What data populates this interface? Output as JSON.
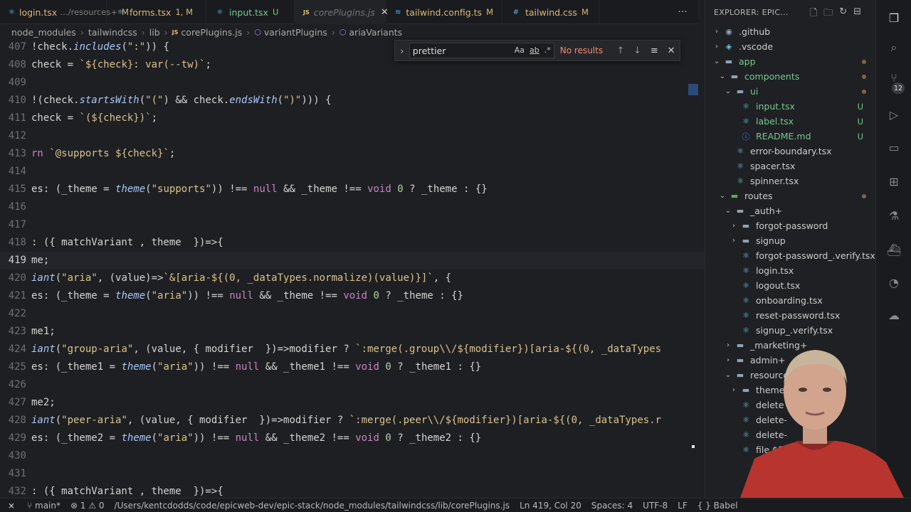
{
  "tabs": [
    {
      "label": "login.tsx",
      "path": "…/resources+",
      "badge": "M",
      "icon": "react-icon"
    },
    {
      "label": "forms.tsx",
      "path": "",
      "badge": "1, M",
      "icon": "react-icon"
    },
    {
      "label": "input.tsx",
      "path": "",
      "badge": "U",
      "icon": "react-icon"
    },
    {
      "label": "corePlugins.js",
      "path": "",
      "badge": "",
      "icon": "js-icon",
      "active": true
    },
    {
      "label": "tailwind.config.ts",
      "path": "",
      "badge": "M",
      "icon": "tailwind-icon"
    },
    {
      "label": "tailwind.css",
      "path": "",
      "badge": "M",
      "icon": "css-icon"
    }
  ],
  "breadcrumb": [
    "node_modules",
    "tailwindcss",
    "lib",
    "corePlugins.js",
    "variantPlugins",
    "ariaVariants"
  ],
  "find": {
    "query": "prettier",
    "opt_case": "Aa",
    "opt_word": "ab",
    "opt_regex": ".*",
    "result": "No results"
  },
  "editor": {
    "lines": [
      {
        "n": "407",
        "t": "!check.includes(\":\")) {"
      },
      {
        "n": "408",
        "t": "check = `${check}: var(--tw)`;"
      },
      {
        "n": "409",
        "t": ""
      },
      {
        "n": "410",
        "t": "!(check.startsWith(\"(\") && check.endsWith(\")\"))) {"
      },
      {
        "n": "411",
        "t": "check = `(${check})`;"
      },
      {
        "n": "412",
        "t": ""
      },
      {
        "n": "413",
        "t": "rn `@supports ${check}`;"
      },
      {
        "n": "414",
        "t": ""
      },
      {
        "n": "415",
        "t": "es: (_theme = theme(\"supports\")) !== null && _theme !== void 0 ? _theme : {}"
      },
      {
        "n": "416",
        "t": ""
      },
      {
        "n": "417",
        "t": ""
      },
      {
        "n": "418",
        "t": ": ({ matchVariant , theme  })=>{"
      },
      {
        "n": "419",
        "t": "me;"
      },
      {
        "n": "420",
        "t": "iant(\"aria\", (value)=>`&[aria-${(0, _dataTypes.normalize)(value)}]`, {"
      },
      {
        "n": "421",
        "t": "es: (_theme = theme(\"aria\")) !== null && _theme !== void 0 ? _theme : {}"
      },
      {
        "n": "422",
        "t": ""
      },
      {
        "n": "423",
        "t": "me1;"
      },
      {
        "n": "424",
        "t": "iant(\"group-aria\", (value, { modifier  })=>modifier ? `:merge(.group\\\\/${modifier})[aria-${(0, _dataTypes"
      },
      {
        "n": "425",
        "t": "es: (_theme1 = theme(\"aria\")) !== null && _theme1 !== void 0 ? _theme1 : {}"
      },
      {
        "n": "426",
        "t": ""
      },
      {
        "n": "427",
        "t": "me2;"
      },
      {
        "n": "428",
        "t": "iant(\"peer-aria\", (value, { modifier  })=>modifier ? `:merge(.peer\\\\/${modifier})[aria-${(0, _dataTypes.r"
      },
      {
        "n": "429",
        "t": "es: (_theme2 = theme(\"aria\")) !== null && _theme2 !== void 0 ? _theme2 : {}"
      },
      {
        "n": "430",
        "t": ""
      },
      {
        "n": "431",
        "t": ""
      },
      {
        "n": "432",
        "t": ": ({ matchVariant , theme  })=>{"
      }
    ],
    "current_line": "419"
  },
  "explorer": {
    "title": "EXPLORER: EPIC...",
    "tree": [
      {
        "label": ".github",
        "depth": 0,
        "kind": "folder",
        "chev": "right",
        "icon": "github-folder-icon"
      },
      {
        "label": ".vscode",
        "depth": 0,
        "kind": "folder",
        "chev": "right",
        "icon": "vscode-folder-icon"
      },
      {
        "label": "app",
        "depth": 0,
        "kind": "folder",
        "chev": "down",
        "icon": "folder-icon",
        "status": "dot",
        "color": "green"
      },
      {
        "label": "components",
        "depth": 1,
        "kind": "folder",
        "chev": "down",
        "icon": "folder-icon",
        "status": "dot",
        "color": "green"
      },
      {
        "label": "ui",
        "depth": 2,
        "kind": "folder",
        "chev": "down",
        "icon": "folder-icon",
        "status": "dot",
        "color": "green"
      },
      {
        "label": "input.tsx",
        "depth": 3,
        "kind": "file",
        "icon": "react-icon",
        "badge": "U",
        "color": "green"
      },
      {
        "label": "label.tsx",
        "depth": 3,
        "kind": "file",
        "icon": "react-icon",
        "badge": "U",
        "color": "green"
      },
      {
        "label": "README.md",
        "depth": 3,
        "kind": "file",
        "icon": "info-icon",
        "badge": "U",
        "color": "green"
      },
      {
        "label": "error-boundary.tsx",
        "depth": 2,
        "kind": "file",
        "icon": "react-icon"
      },
      {
        "label": "spacer.tsx",
        "depth": 2,
        "kind": "file",
        "icon": "react-icon"
      },
      {
        "label": "spinner.tsx",
        "depth": 2,
        "kind": "file",
        "icon": "react-icon"
      },
      {
        "label": "routes",
        "depth": 1,
        "kind": "folder",
        "chev": "down",
        "icon": "folder-green-icon",
        "status": "dot"
      },
      {
        "label": "_auth+",
        "depth": 2,
        "kind": "folder",
        "chev": "down",
        "icon": "folder-icon"
      },
      {
        "label": "forgot-password",
        "depth": 3,
        "kind": "folder",
        "chev": "right",
        "icon": "folder-icon"
      },
      {
        "label": "signup",
        "depth": 3,
        "kind": "folder",
        "chev": "right",
        "icon": "folder-icon"
      },
      {
        "label": "forgot-password_.verify.tsx",
        "depth": 3,
        "kind": "file",
        "icon": "react-icon"
      },
      {
        "label": "login.tsx",
        "depth": 3,
        "kind": "file",
        "icon": "react-icon"
      },
      {
        "label": "logout.tsx",
        "depth": 3,
        "kind": "file",
        "icon": "react-icon"
      },
      {
        "label": "onboarding.tsx",
        "depth": 3,
        "kind": "file",
        "icon": "react-icon"
      },
      {
        "label": "reset-password.tsx",
        "depth": 3,
        "kind": "file",
        "icon": "react-icon"
      },
      {
        "label": "signup_.verify.tsx",
        "depth": 3,
        "kind": "file",
        "icon": "react-icon"
      },
      {
        "label": "_marketing+",
        "depth": 2,
        "kind": "folder",
        "chev": "right",
        "icon": "folder-icon"
      },
      {
        "label": "admin+",
        "depth": 2,
        "kind": "folder",
        "chev": "right",
        "icon": "folder-icon"
      },
      {
        "label": "resource",
        "depth": 2,
        "kind": "folder",
        "chev": "down",
        "icon": "folder-icon"
      },
      {
        "label": "theme",
        "depth": 3,
        "kind": "folder",
        "chev": "right",
        "icon": "folder-icon"
      },
      {
        "label": "delete",
        "depth": 3,
        "kind": "file",
        "icon": "react-icon"
      },
      {
        "label": "delete-",
        "depth": 3,
        "kind": "file",
        "icon": "react-icon"
      },
      {
        "label": "delete-",
        "depth": 3,
        "kind": "file",
        "icon": "react-icon"
      },
      {
        "label": "file.$fil",
        "depth": 3,
        "kind": "file",
        "icon": "react-icon"
      }
    ]
  },
  "activity": {
    "scm_badge": "12"
  },
  "status": {
    "branch": "main*",
    "errors": "1",
    "warnings": "0",
    "path": "/Users/kentcdodds/code/epicweb-dev/epic-stack/node_modules/tailwindcss/lib/corePlugins.js",
    "position": "Ln 419, Col 20",
    "spaces": "Spaces: 4",
    "encoding": "UTF-8",
    "eol": "LF",
    "language": "Babel"
  },
  "colors": {
    "editor_bg": "#1e1f22",
    "string": "#d9c38c",
    "function": "#a8c7fa",
    "keyword": "#c586c0",
    "number": "#b5cea8",
    "git_untracked": "#73c991",
    "git_modified": "#d7ba7d",
    "error": "#f48771"
  }
}
